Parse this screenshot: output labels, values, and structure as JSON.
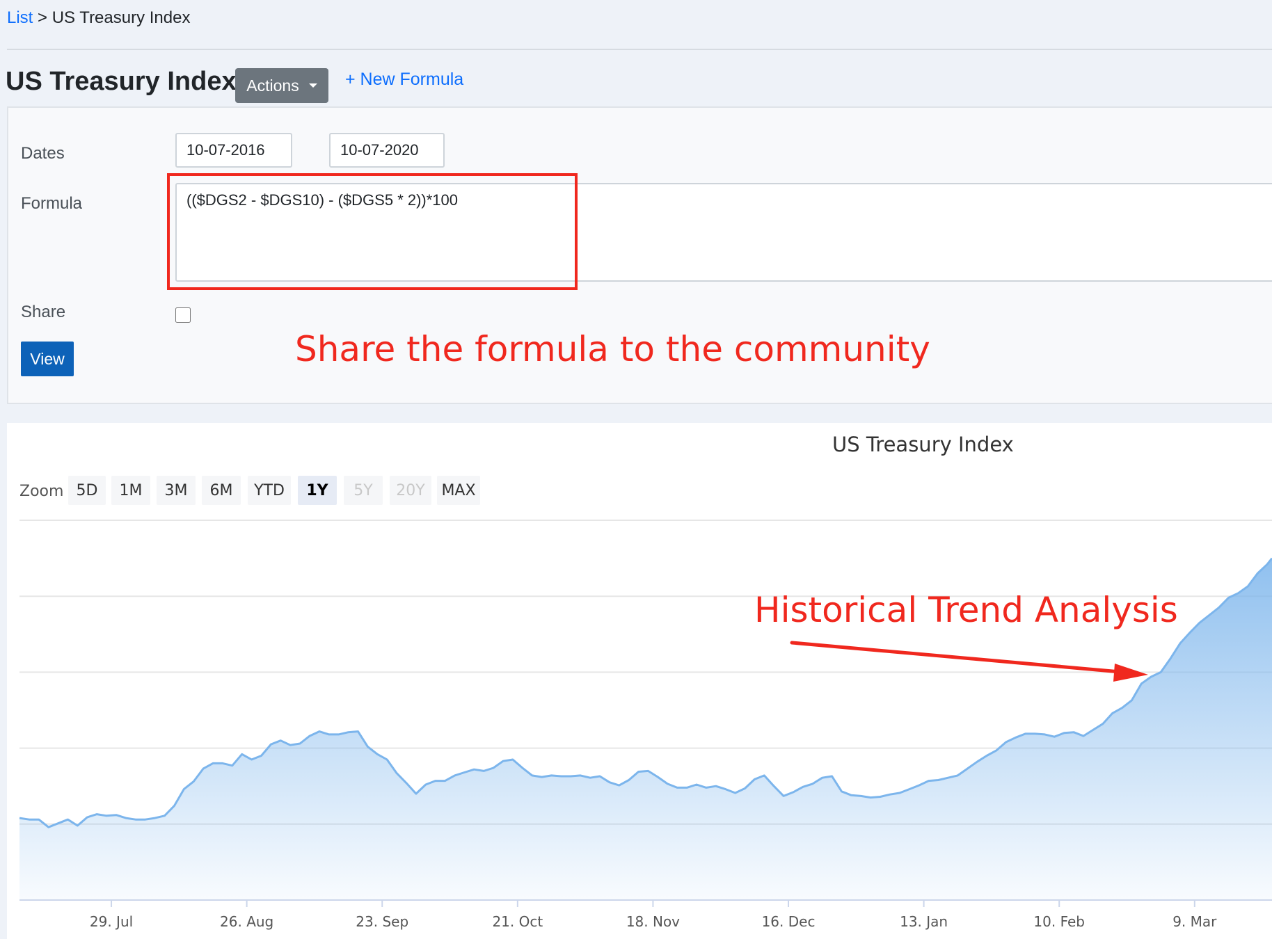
{
  "breadcrumb": {
    "list_link": "List",
    "separator": " > ",
    "current": "US Treasury Index"
  },
  "header": {
    "title": "US Treasury Index",
    "actions_label": "Actions",
    "new_formula_label": "+ New Formula"
  },
  "form": {
    "dates_label": "Dates",
    "start_date": "10-07-2016",
    "end_date": "10-07-2020",
    "formula_label": "Formula",
    "formula_value": "(($DGS2 - $DGS10) - ($DGS5 * 2))*100",
    "share_label": "Share",
    "share_checked": false,
    "view_label": "View"
  },
  "annotations": {
    "share": "Share the formula to the community",
    "trend": "Historical Trend Analysis",
    "color": "#f0281e"
  },
  "zoom": {
    "label": "Zoom",
    "buttons": [
      {
        "label": "5D",
        "state": "normal"
      },
      {
        "label": "1M",
        "state": "normal"
      },
      {
        "label": "3M",
        "state": "normal"
      },
      {
        "label": "6M",
        "state": "normal"
      },
      {
        "label": "YTD",
        "state": "normal"
      },
      {
        "label": "1Y",
        "state": "active"
      },
      {
        "label": "5Y",
        "state": "disabled"
      },
      {
        "label": "20Y",
        "state": "disabled"
      },
      {
        "label": "MAX",
        "state": "normal"
      }
    ]
  },
  "colors": {
    "accent": "#0d6efd",
    "series_line": "#7cb5ec",
    "annotation": "#f0281e"
  },
  "chart_data": {
    "type": "area",
    "title": "US Treasury Index",
    "x_tick_labels": [
      "29. Jul",
      "26. Aug",
      "23. Sep",
      "21. Oct",
      "18. Nov",
      "16. Dec",
      "13. Jan",
      "10. Feb",
      "9. Mar"
    ],
    "x_start_day": -19,
    "x_end_day": 240,
    "grid": true,
    "legend": "none",
    "ylim": [
      0,
      500
    ],
    "series": [
      {
        "x": [
          -19,
          -17,
          -15,
          -13,
          -11,
          -9,
          -7,
          -5,
          -3,
          -1,
          1,
          3,
          5,
          7,
          9,
          11,
          13,
          15,
          17,
          19,
          21,
          23,
          25,
          27,
          29,
          31,
          33,
          35,
          37,
          39,
          41,
          43,
          45,
          47,
          49,
          51,
          53,
          55,
          57,
          59,
          61,
          63,
          65,
          67,
          69,
          71,
          73,
          75,
          77,
          79,
          81,
          83,
          85,
          87,
          89,
          91,
          93,
          95,
          97,
          99,
          101,
          103,
          105,
          107,
          109,
          111,
          113,
          115,
          117,
          119,
          121,
          123,
          125,
          127,
          129,
          131,
          133,
          135,
          137,
          139,
          141,
          143,
          145,
          147,
          149,
          151,
          153,
          155,
          157,
          159,
          161,
          163,
          165,
          167,
          169,
          171,
          173,
          175,
          177,
          179,
          181,
          183,
          185,
          187,
          189,
          191,
          193,
          195,
          197,
          199,
          201,
          203,
          205,
          207,
          209,
          211,
          213,
          215,
          217,
          219,
          221,
          223,
          225,
          227,
          229,
          231,
          233,
          235,
          237,
          239,
          240
        ],
        "y": [
          108,
          106,
          106,
          96,
          101,
          106,
          98,
          109,
          113,
          111,
          112,
          108,
          106,
          106,
          108,
          111,
          124,
          146,
          156,
          173,
          180,
          180,
          177,
          192,
          185,
          190,
          205,
          210,
          204,
          206,
          216,
          222,
          218,
          218,
          221,
          222,
          202,
          192,
          185,
          167,
          154,
          140,
          152,
          157,
          157,
          164,
          168,
          172,
          170,
          174,
          183,
          185,
          174,
          164,
          162,
          164,
          163,
          163,
          164,
          161,
          163,
          155,
          151,
          158,
          169,
          170,
          162,
          153,
          148,
          148,
          152,
          148,
          150,
          146,
          141,
          147,
          159,
          164,
          150,
          137,
          142,
          149,
          153,
          161,
          163,
          143,
          138,
          137,
          135,
          136,
          139,
          141,
          146,
          151,
          157,
          158,
          161,
          164,
          173,
          182,
          190,
          197,
          208,
          214,
          219,
          219,
          218,
          215,
          220,
          221,
          216,
          224,
          232,
          246,
          253,
          263,
          285,
          294,
          300,
          318,
          338,
          352,
          365,
          375,
          385,
          398,
          404,
          413,
          430,
          442,
          450
        ]
      }
    ]
  }
}
